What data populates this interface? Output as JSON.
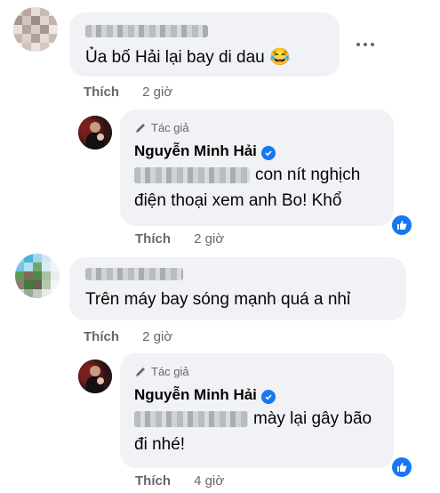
{
  "comments": [
    {
      "text": "Ủa bố Hải lại bay di dau",
      "emoji": "😂",
      "like_label": "Thích",
      "time": "2 giờ"
    },
    {
      "author_tag": "Tác giả",
      "name": "Nguyễn Minh Hải",
      "text_after_blur": "con nít nghịch",
      "text_line2": "điện thoại xem anh Bo! Khổ",
      "like_label": "Thích",
      "time": "2 giờ"
    },
    {
      "text": "Trên máy bay sóng mạnh quá a nhỉ",
      "like_label": "Thích",
      "time": "2 giờ"
    },
    {
      "author_tag": "Tác giả",
      "name": "Nguyễn Minh Hải",
      "text_after_blur": "mày lại gây bão",
      "text_line2": "đi nhé!",
      "like_label": "Thích",
      "time": "4 giờ"
    }
  ],
  "colors": {
    "accent": "#1877f2",
    "bubble": "#f0f2f5",
    "meta": "#65676b"
  },
  "icons": [
    "more-options-icon",
    "pencil-icon",
    "verified-icon",
    "like-reaction-icon",
    "laughing-emoji"
  ]
}
